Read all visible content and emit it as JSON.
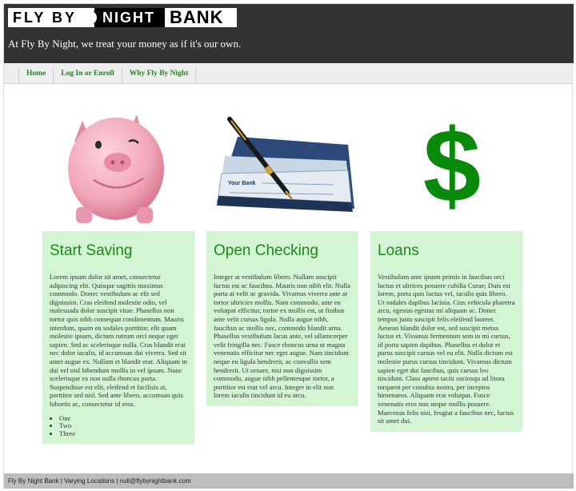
{
  "header": {
    "logo": {
      "part1": "FLY BY",
      "part2": "NIGHT",
      "part3": "BANK"
    },
    "tagline": "At Fly By Night, we treat your money as if it's our own."
  },
  "nav": {
    "items": [
      {
        "label": "Home"
      },
      {
        "label": "Log In or Enroll"
      },
      {
        "label": "Why Fly By Night"
      }
    ]
  },
  "illustrations": {
    "saving": "piggy-bank-icon",
    "checking": "checkbook-pen-icon",
    "loans": "dollar-sign-icon"
  },
  "columns": [
    {
      "title": "Start Saving",
      "body": "Lorem ipsum dolor sit amet, consectetur adipiscing elit. Quisque sagittis maximus commodo. Donec vestibulum ac elit sed dignissim. Cras eleifend molestie odio, vel malesuada dolor suscipit vitae. Phasellus non tortor quis nibh consequat condimentum. Mauris interdum, quam eu sodales porttitor, elit quam molestie ipsum, dictum rutrum orci neque eget sapien. Sed ac scelerisque nulla. Cras blandit erat nec dolor iaculis, id accumsan dui viverra. Sed sit amet augue ex. Nullam et blandit erat. Aliquam in dui vel nisl bibendum mollis in vel ipsum. Nunc scelerisque ex non nulla rhoncus porta. Suspendisse est elit, eleifend et facilisis at, porttitor sed nisl. Sed ante libero, accumsan quis lobortis ac, consectetur id eros.",
      "list": [
        "One",
        "Two",
        "Three"
      ]
    },
    {
      "title": "Open Checking",
      "body": "Integer at vestibulum libero. Nullam suscipit luctus est ac faucibus. Mauris non nibh elit. Nulla porta at velit ac gravida. Vivamus viverra ante at tortor ultricies mollis. Nam commodo, ante eu volutpat efficitur, tortor ex mollis est, ut finibus ante velit cursus ligula. Nulla augue nibh, faucibus ac mollis nec, commodo blandit urna. Phasellus vestibulum lacus ante, vel ullamcorper velit fringilla nec. Fusce rhoncus urna ut magna venenatis efficitur nec eget augue. Nam tincidunt neque eu ligula hendrerit, ac convallis sem hendrerit. Ut ornare, nisi non dignissim commodo, augue nibh pellentesque tortor, a porttitor est erat vel arcu. Integer in elit non lorem iaculis tincidunt id eu arcu."
    },
    {
      "title": "Loans",
      "body": "Vestibulum ante ipsum primis in faucibus orci luctus et ultrices posuere cubilia Curae; Duis est lorem, porta quis luctus vel, iaculis quis libero. Ut sodales dapibus lacinia. Cras vehicula pharetra arcu, egestas egestas mi aliquam ac. Donec tempus justo suscipit felis eleifend laoreet. Aenean blandit dolor est, sed suscipit metus luctus et. Vivamus fermentum sem in mi cursus, id porta sapien dapibus. Phasellus et dolor et purus suscipit cursus vel eu elit. Nulla dictum est molestie purus cursus tincidunt. Vivamus dictum sapien eget dui faucibus, quis cursus leo tincidunt. Class aptent taciti sociosqu ad litora torquent per conubia nostra, per inceptos himenaeos. Aliquam erat volutpat. Fusce venenatis eros non neque mollis posuere. Maecenas felis nisi, feugiat a faucibus nec, luctus sit amet dui."
    }
  ],
  "footer": {
    "text": "Fly By Night Bank | Varying Locations | null@flybynightbank.com"
  },
  "colors": {
    "header_bg": "#333333",
    "accent_green": "#1a8a1a",
    "column_bg": "#d4f5d4",
    "footer_bg": "#bdbdbd"
  }
}
